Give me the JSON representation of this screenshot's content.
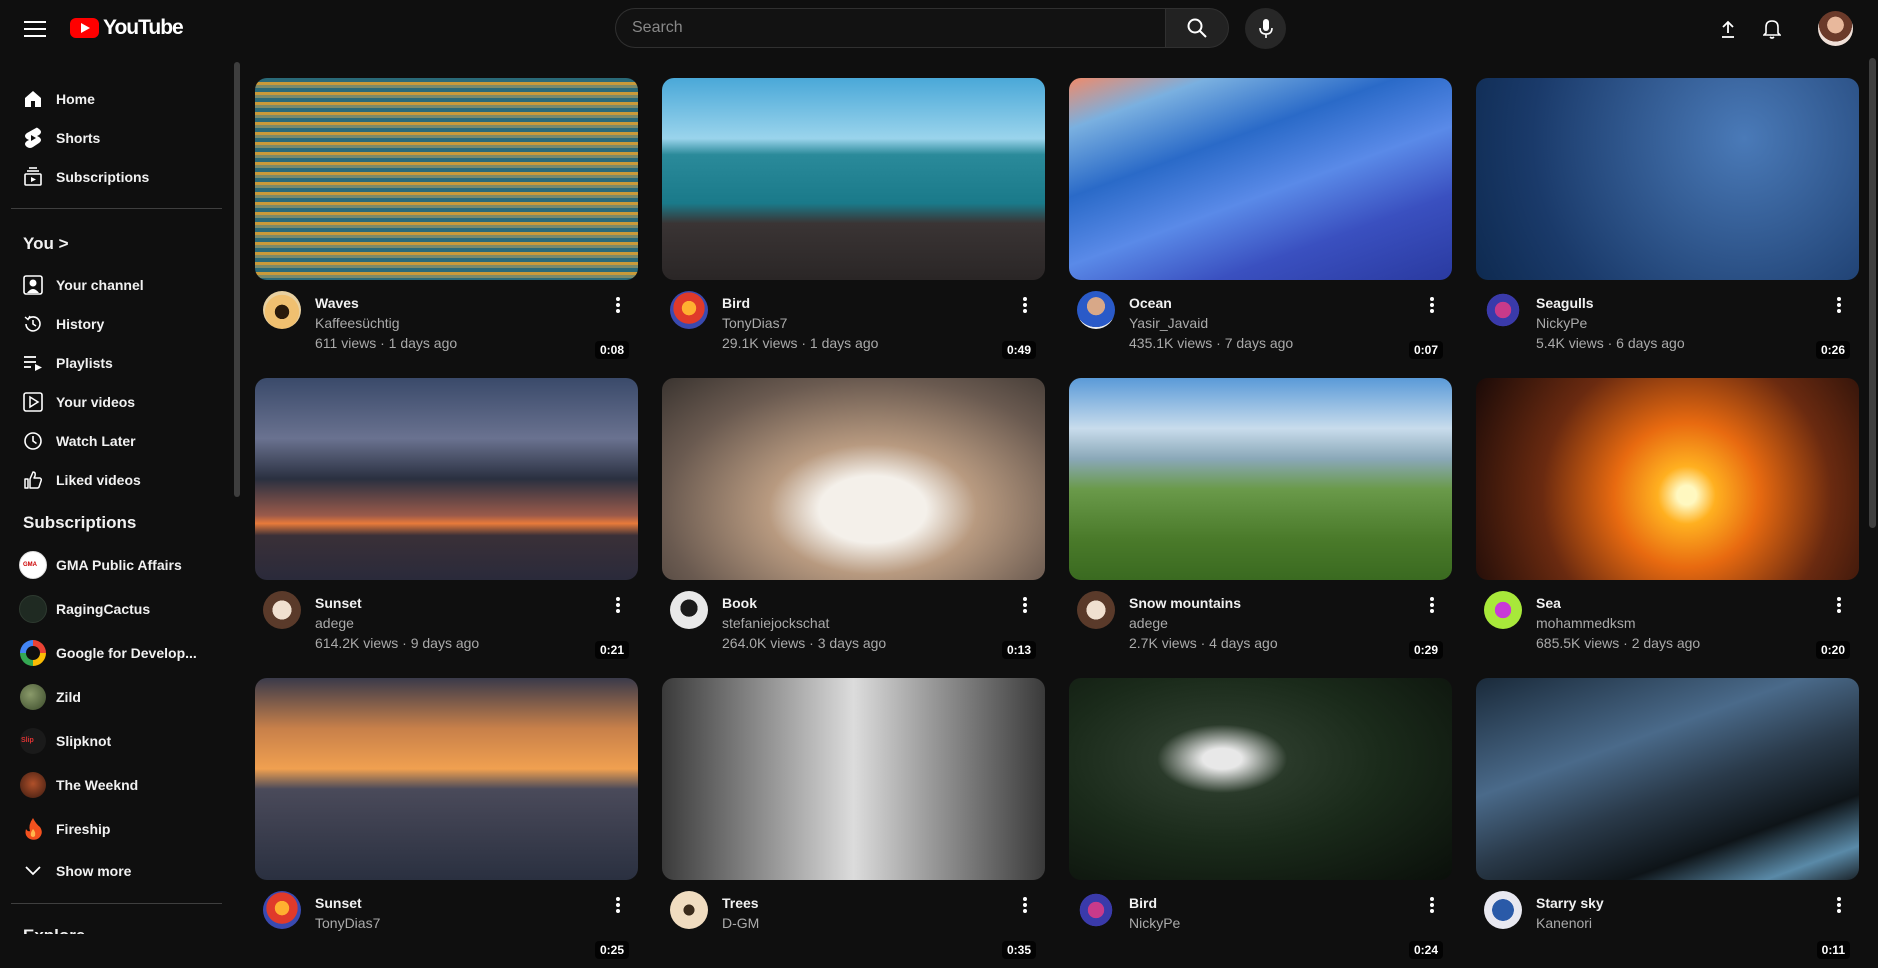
{
  "header": {
    "logo_text": "YouTube",
    "search_placeholder": "Search",
    "icons": [
      "menu-icon",
      "search-icon",
      "mic-icon",
      "upload-icon",
      "bell-icon"
    ]
  },
  "sidebar": {
    "main": [
      {
        "label": "Home",
        "icon": "home-icon"
      },
      {
        "label": "Shorts",
        "icon": "shorts-icon"
      },
      {
        "label": "Subscriptions",
        "icon": "subscriptions-icon"
      }
    ],
    "you_heading": "You >",
    "you_items": [
      {
        "label": "Your channel",
        "icon": "channel-icon"
      },
      {
        "label": "History",
        "icon": "history-icon"
      },
      {
        "label": "Playlists",
        "icon": "playlists-icon"
      },
      {
        "label": "Your videos",
        "icon": "your-videos-icon"
      },
      {
        "label": "Watch Later",
        "icon": "clock-icon"
      },
      {
        "label": "Liked videos",
        "icon": "thumb-up-icon"
      }
    ],
    "subs_heading": "Subscriptions",
    "subscriptions": [
      {
        "label": "GMA Public Affairs",
        "color": "#ffffff"
      },
      {
        "label": "RagingCactus",
        "color": "#1f2a22"
      },
      {
        "label": "Google for Develop...",
        "color": "#ffffff"
      },
      {
        "label": "Zild",
        "color": "#4a5a3a"
      },
      {
        "label": "Slipknot",
        "color": "#1a1a1a"
      },
      {
        "label": "The Weeknd",
        "color": "#6a2a1a"
      },
      {
        "label": "Fireship",
        "color": "#0f0f0f"
      }
    ],
    "show_more": "Show more",
    "next_heading_partial": "Explore"
  },
  "videos": [
    {
      "title": "Waves",
      "channel": "Kaffeesüchtig",
      "meta": "611 views · 1 days ago",
      "duration": "0:08"
    },
    {
      "title": "Bird",
      "channel": "TonyDias7",
      "meta": "29.1K views · 1 days ago",
      "duration": "0:49"
    },
    {
      "title": "Ocean",
      "channel": "Yasir_Javaid",
      "meta": "435.1K views · 7 days ago",
      "duration": "0:07"
    },
    {
      "title": "Seagulls",
      "channel": "NickyPe",
      "meta": "5.4K views · 6 days ago",
      "duration": "0:26"
    },
    {
      "title": "Sunset",
      "channel": "adege",
      "meta": "614.2K views · 9 days ago",
      "duration": "0:21"
    },
    {
      "title": "Book",
      "channel": "stefaniejockschat",
      "meta": "264.0K views · 3 days ago",
      "duration": "0:13"
    },
    {
      "title": "Snow mountains",
      "channel": "adege",
      "meta": "2.7K views · 4 days ago",
      "duration": "0:29"
    },
    {
      "title": "Sea",
      "channel": "mohammedksm",
      "meta": "685.5K views · 2 days ago",
      "duration": "0:20"
    },
    {
      "title": "Sunset",
      "channel": "TonyDias7",
      "meta": "",
      "duration": "0:25"
    },
    {
      "title": "Trees",
      "channel": "D-GM",
      "meta": "",
      "duration": "0:35"
    },
    {
      "title": "Bird",
      "channel": "NickyPe",
      "meta": "",
      "duration": "0:24"
    },
    {
      "title": "Starry sky",
      "channel": "Kanenori",
      "meta": "",
      "duration": "0:11"
    }
  ]
}
